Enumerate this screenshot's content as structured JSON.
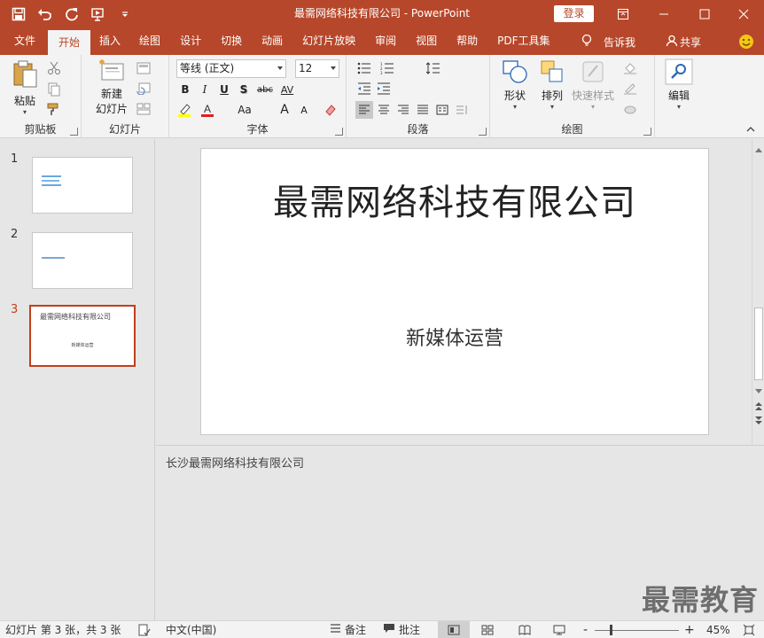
{
  "window": {
    "title": "最需网络科技有限公司  -  PowerPoint",
    "login_label": "登录"
  },
  "tabs": [
    "文件",
    "开始",
    "插入",
    "绘图",
    "设计",
    "切换",
    "动画",
    "幻灯片放映",
    "审阅",
    "视图",
    "帮助",
    "PDF工具集"
  ],
  "active_tab": "开始",
  "tell_me": "告诉我",
  "share": "共享",
  "ribbon": {
    "clipboard": {
      "paste": "粘贴",
      "label": "剪贴板"
    },
    "slides": {
      "new_slide_line1": "新建",
      "new_slide_line2": "幻灯片",
      "label": "幻灯片"
    },
    "font": {
      "font_name": "等线 (正文)",
      "font_size": "12",
      "label": "字体",
      "bold": "B",
      "italic": "I",
      "underline": "U",
      "shadow": "S",
      "strike": "abc",
      "spacing": "AV",
      "case": "Aa",
      "grow": "A",
      "shrink": "A"
    },
    "paragraph": {
      "label": "段落"
    },
    "drawing": {
      "shapes": "形状",
      "arrange": "排列",
      "quick_styles": "快速样式",
      "label": "绘图"
    },
    "editing": {
      "label": "编辑"
    }
  },
  "slides": [
    {
      "number": "1"
    },
    {
      "number": "2"
    },
    {
      "number": "3",
      "title": "最需网络科技有限公司",
      "subtitle": "新媒体运营"
    }
  ],
  "current_slide": {
    "title": "最需网络科技有限公司",
    "subtitle": "新媒体运营"
  },
  "notes": "长沙最需网络科技有限公司",
  "watermark": "最需教育",
  "statusbar": {
    "slide_info": "幻灯片 第 3 张，共 3 张",
    "language": "中文(中国)",
    "notes_btn": "备注",
    "comments_btn": "批注",
    "zoom": "45%",
    "zoom_minus": "-",
    "zoom_plus": "+"
  },
  "colors": {
    "brand": "#b7472a",
    "active_slide_border": "#c43e1c"
  }
}
